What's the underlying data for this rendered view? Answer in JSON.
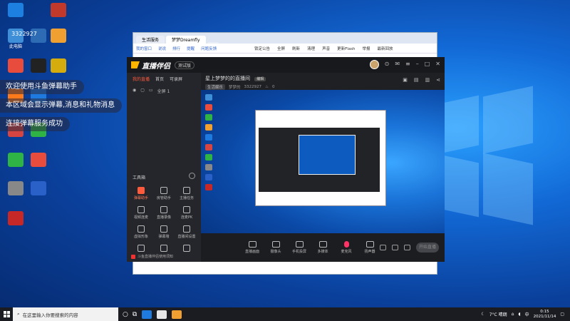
{
  "desktop": {
    "icons": [
      {
        "label": "",
        "color": "#1d7fe0"
      },
      {
        "label": "",
        "color": "#c0392b"
      },
      {
        "label": "此电脑",
        "color": "#3f8fd8"
      },
      {
        "label": "",
        "color": "#2d6cb5"
      },
      {
        "label": "",
        "color": "#f0a030"
      },
      {
        "label": "",
        "color": "#e74c3c"
      },
      {
        "label": "",
        "color": "#222"
      },
      {
        "label": "",
        "color": "#d4ac0d"
      },
      {
        "label": "",
        "color": "#ff7a1a"
      },
      {
        "label": "",
        "color": "#1f7ae0"
      },
      {
        "label": "",
        "color": "#d64541"
      },
      {
        "label": "",
        "color": "#2fb344"
      },
      {
        "label": "",
        "color": "#2fb344"
      },
      {
        "label": "",
        "color": "#e74c3c"
      },
      {
        "label": "",
        "color": "#888"
      },
      {
        "label": "",
        "color": "#2a61c9"
      },
      {
        "label": "",
        "color": "#c62828"
      }
    ],
    "overlay_id": "3322927"
  },
  "toasts": [
    {
      "text": "欢迎使用斗鱼弹幕助手"
    },
    {
      "text": "本区域会显示弹幕,消息和礼物消息"
    },
    {
      "text": "连接弹幕服务成功"
    }
  ],
  "back_window": {
    "tabs": [
      "生活服务",
      "梦梦Dreamfly",
      ""
    ],
    "toolbar": [
      "我的窗口",
      "说说",
      "排行",
      "提醒",
      "问题反馈"
    ],
    "toolbar_right": [
      "锁定公告",
      "全屏",
      "刷新",
      "清理",
      "声音",
      "更新Flash",
      "举报",
      "最新回放"
    ]
  },
  "app": {
    "logo": "直播伴侣",
    "version_btn": "测试版",
    "left_tabs": [
      "我的直播",
      "首页",
      "可录屏"
    ],
    "scene_label": "全屏 1",
    "tools_header": "工具箱",
    "tools": [
      {
        "label": "弹幕助手",
        "hot": true
      },
      {
        "label": "房管助手",
        "hot": false
      },
      {
        "label": "主播任务",
        "hot": false
      },
      {
        "label": "视频连麦",
        "hot": false
      },
      {
        "label": "直播录像",
        "hot": false
      },
      {
        "label": "连麦PK",
        "hot": false
      },
      {
        "label": "虚拟形象",
        "hot": false
      },
      {
        "label": "弹幕墙",
        "hot": false
      },
      {
        "label": "直播间设置",
        "hot": false
      },
      {
        "label": "",
        "hot": false
      },
      {
        "label": "",
        "hot": false
      },
      {
        "label": "",
        "hot": false
      }
    ],
    "left_footer": "斗鱼直播伴侣使用须知",
    "room_title": "星上梦梦的的直播间",
    "room_edit": "编辑",
    "room_category": "生活娱乐",
    "room_owner": "梦梦的",
    "room_id": "3322927",
    "room_count": "0",
    "bottom_actions": [
      {
        "label": "直播画面",
        "kind": "normal"
      },
      {
        "label": "摄像头",
        "kind": "normal"
      },
      {
        "label": "手机投屏",
        "kind": "normal"
      },
      {
        "label": "多媒体",
        "kind": "normal"
      },
      {
        "label": "麦克风",
        "kind": "mic"
      },
      {
        "label": "扬声器",
        "kind": "normal"
      }
    ],
    "start_button": "开始直播"
  },
  "taskbar": {
    "search_placeholder": "在这里输入你要搜索的内容",
    "weather": "7°C 晴朗",
    "ime": "中",
    "time": "0:15",
    "date": "2021/11/14"
  }
}
